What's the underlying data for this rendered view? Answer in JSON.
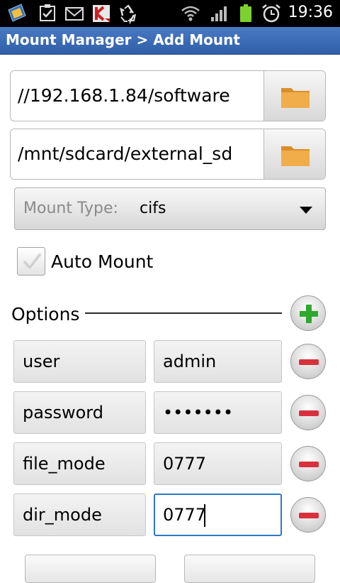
{
  "status_bar": {
    "time": "19:36",
    "icons": [
      "app-icon",
      "checklist-icon",
      "gmail-icon",
      "kaspersky-icon",
      "recycle-icon",
      "wifi-icon",
      "signal-icon",
      "battery-icon",
      "alarm-icon"
    ]
  },
  "titlebar": {
    "title": "Mount Manager > Add Mount"
  },
  "source": {
    "value": "//192.168.1.84/software",
    "browse_icon": "folder-icon"
  },
  "target": {
    "value": "/mnt/sdcard/external_sd",
    "browse_icon": "folder-icon"
  },
  "mount_type": {
    "label": "Mount Type:",
    "value": "cifs"
  },
  "auto_mount": {
    "label": "Auto Mount",
    "checked": true
  },
  "options": {
    "label": "Options",
    "rows": [
      {
        "key": "user",
        "value": "admin"
      },
      {
        "key": "password",
        "value": "•••••••"
      },
      {
        "key": "file_mode",
        "value": "0777"
      },
      {
        "key": "dir_mode",
        "value": "0777"
      }
    ]
  },
  "colors": {
    "titlebar": "#3a6bb6",
    "folder": "#e9a443",
    "add": "#2fa82f",
    "remove": "#d9313c",
    "focus": "#2e78c7"
  }
}
